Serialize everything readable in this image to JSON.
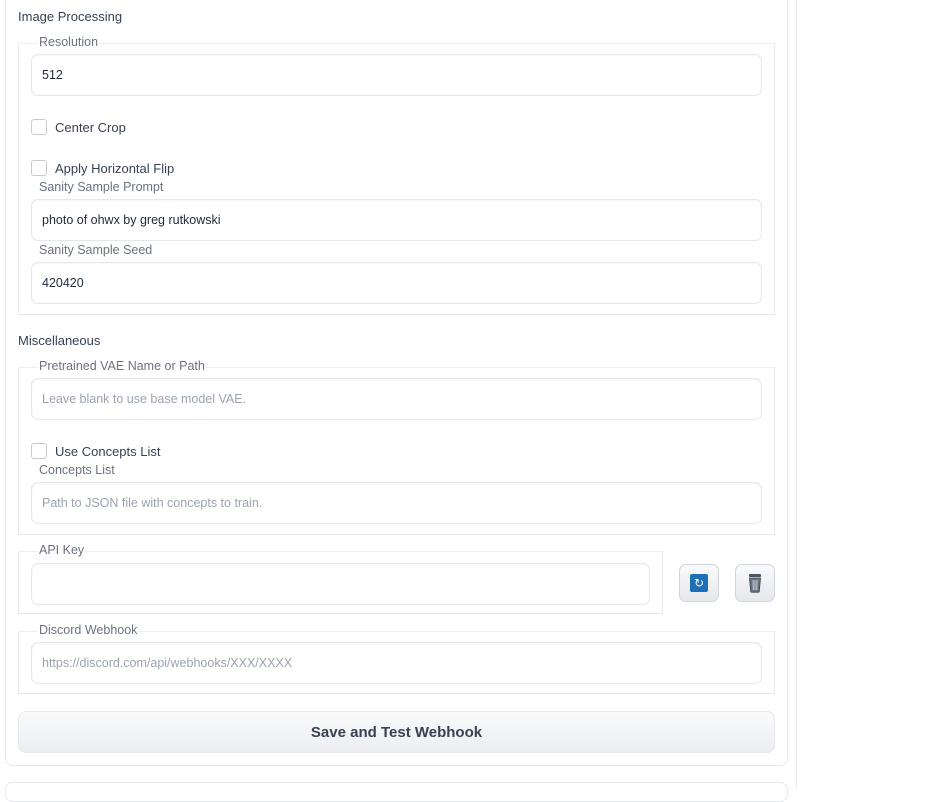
{
  "image_processing": {
    "title": "Image Processing",
    "resolution": {
      "label": "Resolution",
      "value": "512"
    },
    "center_crop": {
      "label": "Center Crop",
      "checked": false
    },
    "horizontal_flip": {
      "label": "Apply Horizontal Flip",
      "checked": false
    },
    "sanity_prompt": {
      "label": "Sanity Sample Prompt",
      "value": "photo of ohwx by greg rutkowski"
    },
    "sanity_seed": {
      "label": "Sanity Sample Seed",
      "value": "420420"
    }
  },
  "miscellaneous": {
    "title": "Miscellaneous",
    "vae": {
      "label": "Pretrained VAE Name or Path",
      "placeholder": "Leave blank to use base model VAE."
    },
    "use_concepts": {
      "label": "Use Concepts List",
      "checked": false
    },
    "concepts_list": {
      "label": "Concepts List",
      "placeholder": "Path to JSON file with concepts to train."
    }
  },
  "api_key": {
    "label": "API Key",
    "value": "",
    "refresh_icon": "refresh-icon",
    "delete_icon": "trash-icon"
  },
  "discord_webhook": {
    "label": "Discord Webhook",
    "placeholder": "https://discord.com/api/webhooks/XXX/XXXX"
  },
  "save_button_label": "Save and Test Webhook",
  "colors": {
    "refresh_accent": "#1f6fb5",
    "border": "#e5e7eb"
  }
}
